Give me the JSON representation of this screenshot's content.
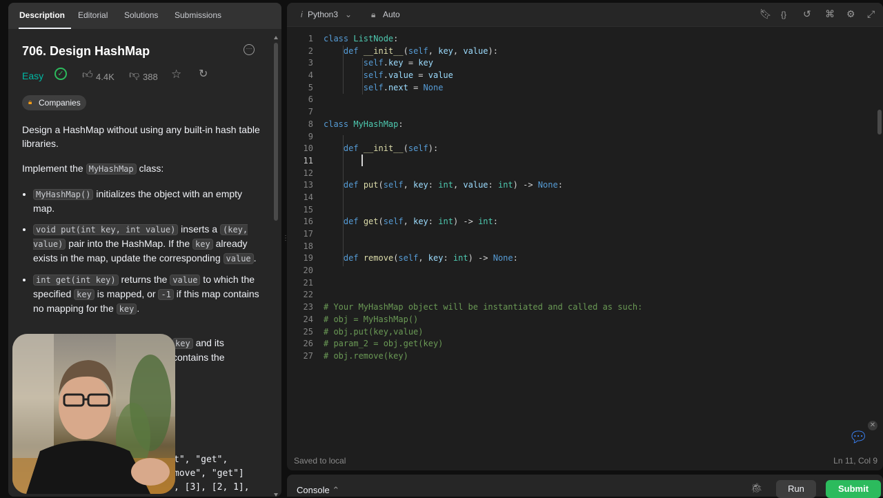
{
  "left_panel": {
    "tabs": [
      {
        "label": "Description"
      },
      {
        "label": "Editorial"
      },
      {
        "label": "Solutions"
      },
      {
        "label": "Submissions"
      }
    ],
    "title": "706. Design HashMap",
    "difficulty": "Easy",
    "likes": "4.4K",
    "dislikes": "388",
    "companies_label": "Companies",
    "intro": "Design a HashMap without using any built-in hash table libraries.",
    "implement_prefix": "Implement the ",
    "implement_code": "MyHashMap",
    "implement_suffix": " class:",
    "bullets": [
      {
        "code": "MyHashMap()",
        "text": " initializes the object with an empty map."
      },
      {
        "code": "void put(int key, int value)",
        "text1": " inserts a ",
        "code2": "(key, value)",
        "text2": " pair into the HashMap. If the ",
        "code3": "key",
        "text3": " already exists in the map, update the corresponding ",
        "code4": "value",
        "text4": "."
      },
      {
        "code": "int get(int key)",
        "text1": " returns the ",
        "code2": "value",
        "text2": " to which the specified ",
        "code3": "key",
        "text3": " is mapped, or ",
        "code4": "-1",
        "text4": " if this map contains no mapping for the ",
        "code5": "key",
        "text5": "."
      }
    ],
    "partial_line1_code": "key",
    "partial_line1_text": " and its",
    "partial_line2_text": "contains the",
    "example_line1": "t\", \"get\",",
    "example_line2": "move\", \"get\"]",
    "example_line3": ", [3], [2, 1],"
  },
  "editor": {
    "language": "Python3",
    "mode": "Auto",
    "saved_status": "Saved to local",
    "cursor_pos": "Ln 11, Col 9",
    "line_numbers": [
      "1",
      "2",
      "3",
      "4",
      "5",
      "6",
      "7",
      "8",
      "9",
      "10",
      "11",
      "12",
      "13",
      "14",
      "15",
      "16",
      "17",
      "18",
      "19",
      "20",
      "21",
      "22",
      "23",
      "24",
      "25",
      "26",
      "27"
    ],
    "comment_lines": [
      "# Your MyHashMap object will be instantiated and called as such:",
      "# obj = MyHashMap()",
      "# obj.put(key,value)",
      "# param_2 = obj.get(key)",
      "# obj.remove(key)"
    ]
  },
  "console": {
    "label": "Console",
    "run_label": "Run",
    "submit_label": "Submit"
  },
  "colors": {
    "accent_green": "#2cbb5d",
    "easy": "#00b8a3",
    "chat_blue": "#3b82f6"
  }
}
